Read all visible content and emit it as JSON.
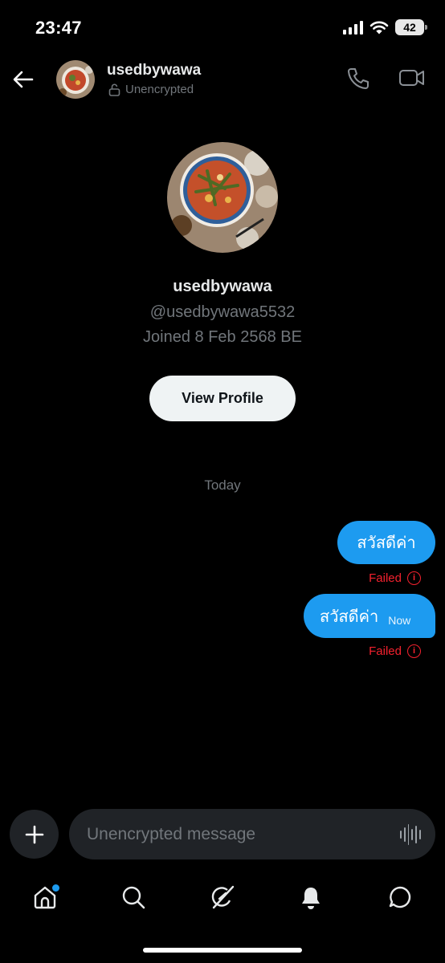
{
  "status_bar": {
    "time": "23:47",
    "battery": "42"
  },
  "header": {
    "name": "usedbywawa",
    "encryption": "Unencrypted"
  },
  "profile": {
    "name": "usedbywawa",
    "handle": "@usedbywawa5532",
    "joined": "Joined 8 Feb 2568 BE",
    "view_profile_label": "View Profile"
  },
  "date_separator": "Today",
  "messages": [
    {
      "text": "สวัสดีค่า",
      "time": "",
      "status": "Failed"
    },
    {
      "text": "สวัสดีค่า",
      "time": "Now",
      "status": "Failed"
    }
  ],
  "composer": {
    "placeholder": "Unencrypted message"
  },
  "nav": {
    "items": [
      "home-icon",
      "search-icon",
      "grok-icon",
      "notifications-icon",
      "messages-icon"
    ],
    "home_has_dot": true
  },
  "colors": {
    "accent": "#1d9bf0",
    "error": "#f4212e",
    "background": "#000000"
  }
}
